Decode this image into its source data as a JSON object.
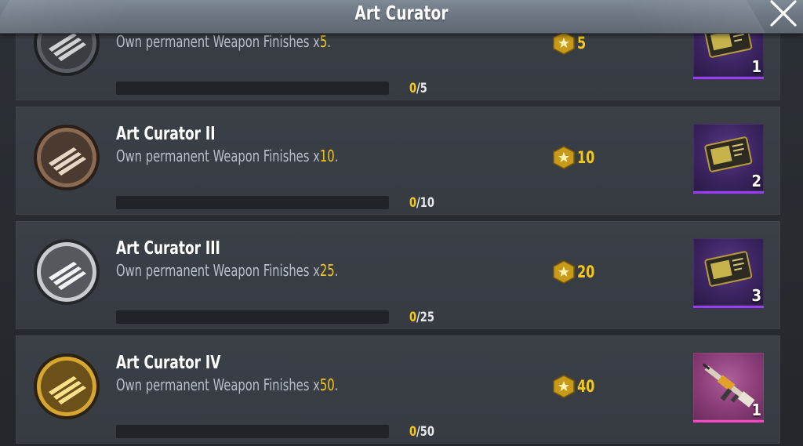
{
  "header": {
    "title": "Art Curator"
  },
  "achievements": [
    {
      "title": "",
      "desc_prefix": "Own permanent Weapon Finishes x",
      "desc_count": "5",
      "desc_suffix": ".",
      "progress_current": "0",
      "progress_total": "/5",
      "progress_fraction": 0,
      "points": "5",
      "reward_qty": "1",
      "reward_icon": "weapon-crate-voucher-icon",
      "medal": "silver-dark",
      "reward_color": "#9a3bff"
    },
    {
      "title": "Art Curator II",
      "desc_prefix": "Own permanent Weapon Finishes x",
      "desc_count": "10",
      "desc_suffix": ".",
      "progress_current": "0",
      "progress_total": "/10",
      "progress_fraction": 0,
      "points": "10",
      "reward_qty": "2",
      "reward_icon": "weapon-crate-voucher-icon",
      "medal": "bronze",
      "reward_color": "#9a3bff"
    },
    {
      "title": "Art Curator III",
      "desc_prefix": "Own permanent Weapon Finishes x",
      "desc_count": "25",
      "desc_suffix": ".",
      "progress_current": "0",
      "progress_total": "/25",
      "progress_fraction": 0,
      "points": "20",
      "reward_qty": "3",
      "reward_icon": "weapon-crate-voucher-icon",
      "medal": "silver",
      "reward_color": "#9a3bff"
    },
    {
      "title": "Art Curator IV",
      "desc_prefix": "Own permanent Weapon Finishes x",
      "desc_count": "50",
      "desc_suffix": ".",
      "progress_current": "0",
      "progress_total": "/50",
      "progress_fraction": 0,
      "points": "40",
      "reward_qty": "1",
      "reward_icon": "rifle-skin-icon",
      "medal": "gold",
      "reward_color": "#ff47c8"
    }
  ],
  "colors": {
    "accent_yellow": "#f4c81b",
    "epic_purple": "#9a3bff",
    "legendary_pink": "#ff47c8"
  }
}
